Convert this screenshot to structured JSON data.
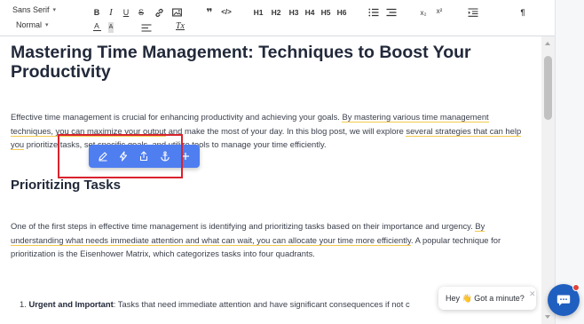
{
  "toolbar": {
    "font_family": "Sans Serif",
    "font_size": "Normal",
    "headings": [
      "H1",
      "H2",
      "H3",
      "H4",
      "H5",
      "H6"
    ],
    "bold": "B",
    "italic": "I",
    "underline": "U",
    "strike": "S",
    "subscript": "x₂",
    "superscript": "x²",
    "text_color": "A",
    "background_color": "A",
    "clean_format": "Tx",
    "paragraph_mark": "¶"
  },
  "article": {
    "title": "Mastering Time Management: Techniques to Boost Your Productivity",
    "p1": {
      "part1": "Effective time management is crucial for enhancing productivity and achieving your goals. ",
      "hl1": "By mastering various time management techniques, you can maximize your output",
      "part2": " and make the most of your day. In this blog post, we will explore ",
      "hl2": "several strategies that can help you",
      "part3": " prioritize tasks, set specific goals, and utilize tools to manage your time efficiently."
    },
    "h2": "Prioritizing Tasks",
    "p2": {
      "part1": "One of the first steps in effective time management is identifying and prioritizing tasks based on their importance and urgency. ",
      "hl1": "By understanding what needs immediate attention and what can wait, you can allocate your time more efficiently",
      "part2": ". A popular technique for prioritization is the Eisenhower Matrix, which categorizes tasks into four quadrants."
    },
    "list_item_1": {
      "number": "1.",
      "bold": "Urgent and Important",
      "text": ": Tasks that need immediate attention and have significant consequences if not c"
    }
  },
  "chat": {
    "greeting": "Hey 👋 Got a minute?",
    "close": "✕"
  },
  "colors": {
    "accent": "#4f7ef0",
    "highlight_underline": "#f2c94c",
    "annotation_box": "#d9232d",
    "chat_launcher": "#1f5fbf"
  }
}
